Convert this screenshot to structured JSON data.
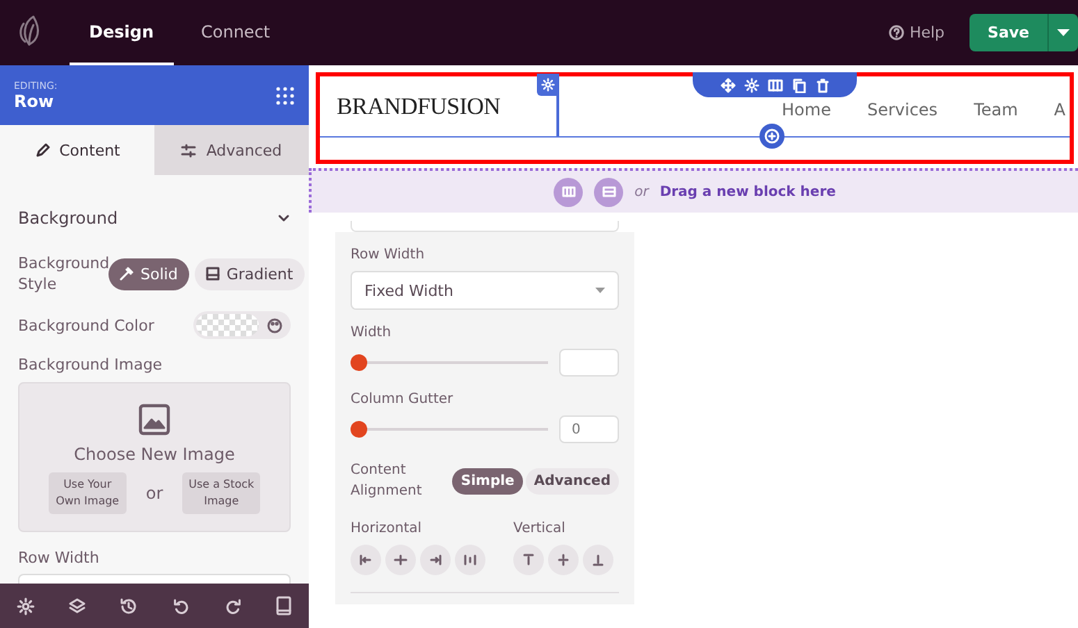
{
  "topbar": {
    "tabs": [
      {
        "label": "Design",
        "selected": true
      },
      {
        "label": "Connect",
        "selected": false
      }
    ],
    "help": "Help",
    "save": "Save"
  },
  "sidebar": {
    "editing_label": "EDITING:",
    "editing_title": "Row",
    "tabs": [
      {
        "label": "Content",
        "selected": true,
        "kind": "content"
      },
      {
        "label": "Advanced",
        "selected": false,
        "kind": "advanced"
      }
    ],
    "section": {
      "title": "Background",
      "expanded": true
    },
    "background_style": {
      "label": "Background Style",
      "options": [
        {
          "label": "Solid",
          "selected": true,
          "kind": "solid"
        },
        {
          "label": "Gradient",
          "selected": false,
          "kind": "gradient"
        }
      ]
    },
    "background_color": {
      "label": "Background Color"
    },
    "background_image": {
      "label": "Background Image",
      "choose": "Choose New Image",
      "own": "Use Your Own Image",
      "or": "or",
      "stock": "Use a Stock Image"
    },
    "row_width_label": "Row Width"
  },
  "canvas": {
    "logo": "BRANDFUSION",
    "nav": [
      "Home",
      "Services",
      "Team",
      "A"
    ],
    "drop_zone": {
      "or": "or",
      "text": "Drag a new block here"
    }
  },
  "panel": {
    "row_width": {
      "label": "Row Width",
      "value": "Fixed Width"
    },
    "sliders": [
      {
        "label": "Width",
        "level": 0
      },
      {
        "label": "Column Gutter",
        "level": 0,
        "value": "0"
      }
    ],
    "alignment": {
      "label": "Content Alignment",
      "options": [
        {
          "label": "Simple",
          "selected": true
        },
        {
          "label": "Advanced",
          "selected": false
        }
      ]
    },
    "horizontal": "Horizontal",
    "vertical": "Vertical"
  }
}
